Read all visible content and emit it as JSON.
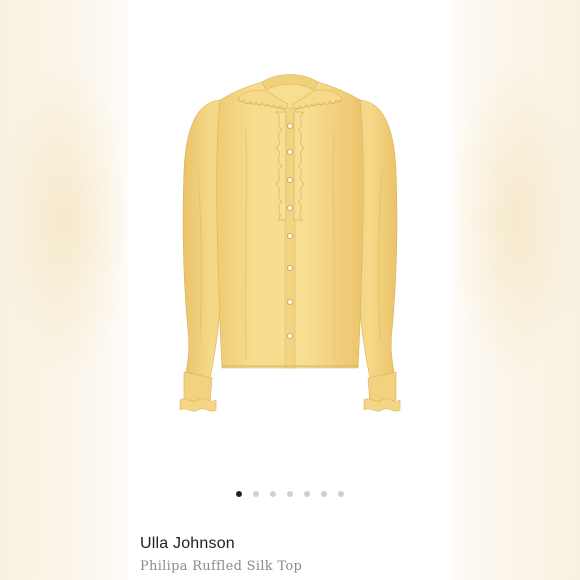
{
  "product": {
    "brand": "Ulla Johnson",
    "name": "Philipa Ruffled Silk Top",
    "image_alt": "yellow-silk-blouse-photo"
  },
  "carousel": {
    "total_images": 7,
    "active_index": 0
  },
  "colors": {
    "blouse": "#F6D98A",
    "blouse_shadow": "#E6C46E",
    "background_blur": "#F8F1E2",
    "dot_active": "#222222",
    "dot_inactive": "#D0D0D0"
  }
}
